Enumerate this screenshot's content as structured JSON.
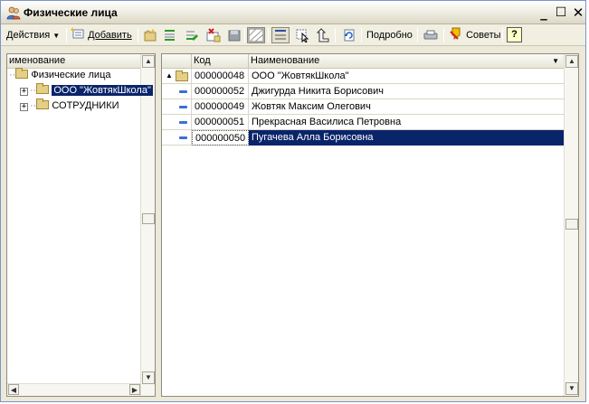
{
  "window": {
    "title": "Физические лица",
    "buttons": {
      "minimize": "_",
      "maximize": "☐",
      "close": "✕"
    }
  },
  "toolbar": {
    "actions_label": "Действия",
    "add_label": "Добавить",
    "details_label": "Подробно",
    "tips_label": "Советы",
    "help_label": "?"
  },
  "tree": {
    "header": "именование",
    "root": "Физические лица",
    "items": [
      {
        "label": "ООО \"ЖовтякШкола\"",
        "selected": true
      },
      {
        "label": "СОТРУДНИКИ",
        "selected": false
      }
    ]
  },
  "table": {
    "headers": {
      "code": "Код",
      "name": "Наименование"
    },
    "rows": [
      {
        "type": "group-up",
        "code": "000000048",
        "name": "ООО \"ЖовтякШкола\""
      },
      {
        "type": "element",
        "code": "000000052",
        "name": "Джигурда Никита Борисович"
      },
      {
        "type": "element",
        "code": "000000049",
        "name": "Жовтяк Максим Олегович"
      },
      {
        "type": "element",
        "code": "000000051",
        "name": "Прекрасная Василиса Петровна"
      },
      {
        "type": "element",
        "code": "000000050",
        "name": "Пугачева Алла Борисовна",
        "selected": true
      }
    ]
  },
  "icons": {
    "title": "people-icon",
    "colors": {
      "selection": "#0a246a",
      "folder": "#e4cf85",
      "element_marker": "#3b6fd0"
    }
  }
}
